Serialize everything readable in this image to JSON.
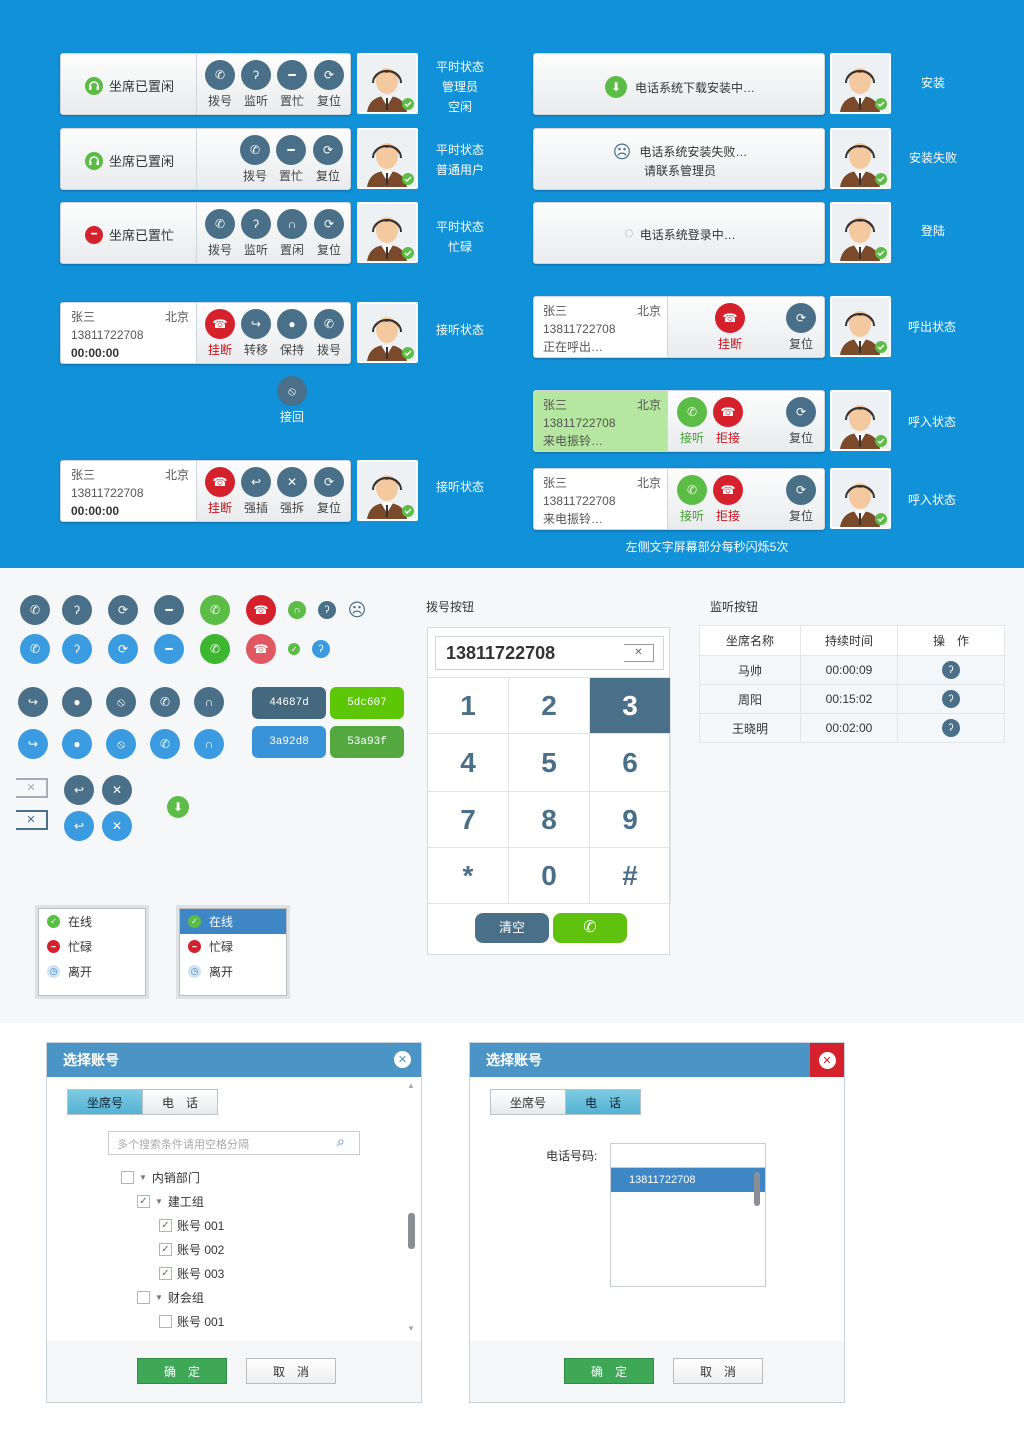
{
  "colors": {
    "top_bg": "#1191d8",
    "icon_dark": "#4a6f88",
    "icon_red": "#d5212c",
    "icon_green": "#5bbd45",
    "icon_blue": "#3a9be0",
    "incoming_bg": "#b5e7a0",
    "dialog_header": "#4b95c6",
    "confirm_green": "#3ea857",
    "close_red": "#d5212c"
  },
  "labels": {
    "dial": "拨号",
    "monitor": "监听",
    "set_busy": "置忙",
    "set_idle": "置闲",
    "reset": "复位",
    "hangup": "挂断",
    "transfer": "转移",
    "hold": "保持",
    "retrieve": "接回",
    "barge": "强插",
    "force_release": "强拆",
    "answer": "接听",
    "reject": "拒接"
  },
  "status": {
    "idle": "坐席已置闲",
    "busy": "坐席已置忙"
  },
  "notes": {
    "normal_admin": [
      "平时状态",
      "管理员",
      "空闲"
    ],
    "normal_user": [
      "平时状态",
      "普通用户"
    ],
    "normal_busy": [
      "平时状态",
      "忙碌"
    ],
    "answering": "接听状态",
    "install": "安装",
    "install_failed": "安装失败",
    "login": "登陆",
    "outgoing": "呼出状态",
    "incoming": "呼入状态",
    "blink_note": "左侧文字屏幕部分每秒闪烁5次"
  },
  "messages": {
    "downloading": "电话系统下载安装中…",
    "failed_line1": "电话系统安装失败…",
    "failed_line2": "请联系管理员",
    "logging_in": "电话系统登录中…"
  },
  "caller": {
    "name": "张三",
    "city": "北京",
    "phone": "13811722708",
    "timer": "00:00:00",
    "calling": "正在呼出…",
    "ringing": "来电振铃…"
  },
  "icons": [
    "phone-icon",
    "ear-icon",
    "reset-icon",
    "minus-icon",
    "hangup-icon",
    "headset-icon",
    "sad-face-icon",
    "transfer-icon",
    "mic-icon",
    "mute-icon",
    "backspace-icon",
    "barge-icon",
    "force-release-icon",
    "download-icon"
  ],
  "chips": [
    {
      "text": "44687d",
      "color": "#44687d"
    },
    {
      "text": "5dc607",
      "color": "#5dc607"
    },
    {
      "text": "3a92d8",
      "color": "#3a92d8"
    },
    {
      "text": "53a93f",
      "color": "#53a93f"
    }
  ],
  "status_menu": {
    "items": [
      "在线",
      "忙碌",
      "离开"
    ]
  },
  "dialpad": {
    "title": "拨号按钮",
    "number": "13811722708",
    "keys": [
      "1",
      "2",
      "3",
      "4",
      "5",
      "6",
      "7",
      "8",
      "9",
      "*",
      "0",
      "#"
    ],
    "active_key": "3",
    "clear": "清空"
  },
  "monitor_table": {
    "title": "监听按钮",
    "headers": [
      "坐席名称",
      "持续时间",
      "操　作"
    ],
    "rows": [
      {
        "name": "马帅",
        "duration": "00:00:09"
      },
      {
        "name": "周阳",
        "duration": "00:15:02"
      },
      {
        "name": "王晓明",
        "duration": "00:02:00"
      }
    ]
  },
  "dialog1": {
    "title": "选择账号",
    "tabs": [
      "坐席号",
      "电　话"
    ],
    "search_placeholder": "多个搜索条件请用空格分隔",
    "tree": [
      "内销部门",
      "建工组",
      "账号 001",
      "账号 002",
      "账号 003",
      "财会组",
      "账号 001"
    ],
    "ok": "确　定",
    "cancel": "取　消"
  },
  "dialog2": {
    "title": "选择账号",
    "tabs": [
      "坐席号",
      "电　话"
    ],
    "phone_label": "电话号码:",
    "list_item": "13811722708",
    "ok": "确　定",
    "cancel": "取　消"
  }
}
